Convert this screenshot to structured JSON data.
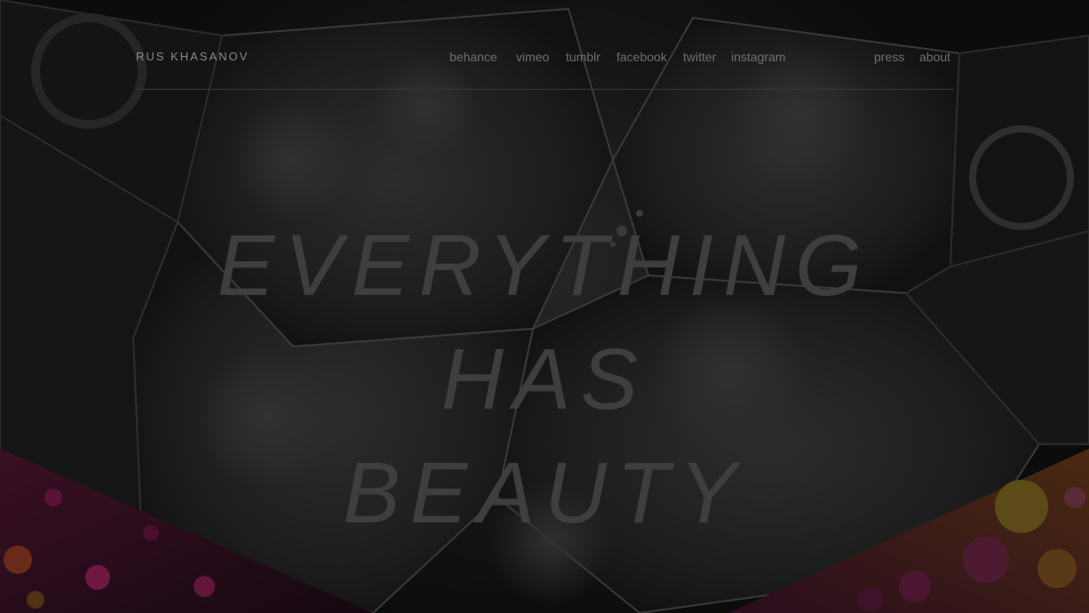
{
  "header": {
    "site_title": "RUS KHASANOV",
    "nav_links": [
      "behance",
      "vimeo",
      "tumblr",
      "facebook",
      "twitter",
      "instagram"
    ],
    "secondary_links": [
      "press",
      "about"
    ]
  },
  "hero": {
    "headline_lines": [
      "EVERYTHING",
      "HAS",
      "BEAUTY"
    ]
  },
  "colors": {
    "background": "#0b0b0b",
    "headline": "#3e3e3e",
    "nav_text": "#6f6f6f",
    "title_text": "#8a8a8a",
    "divider": "#3a3a3a",
    "bubble_accent_pink": "#b8307a",
    "bubble_accent_yellow": "#d9b02a"
  }
}
